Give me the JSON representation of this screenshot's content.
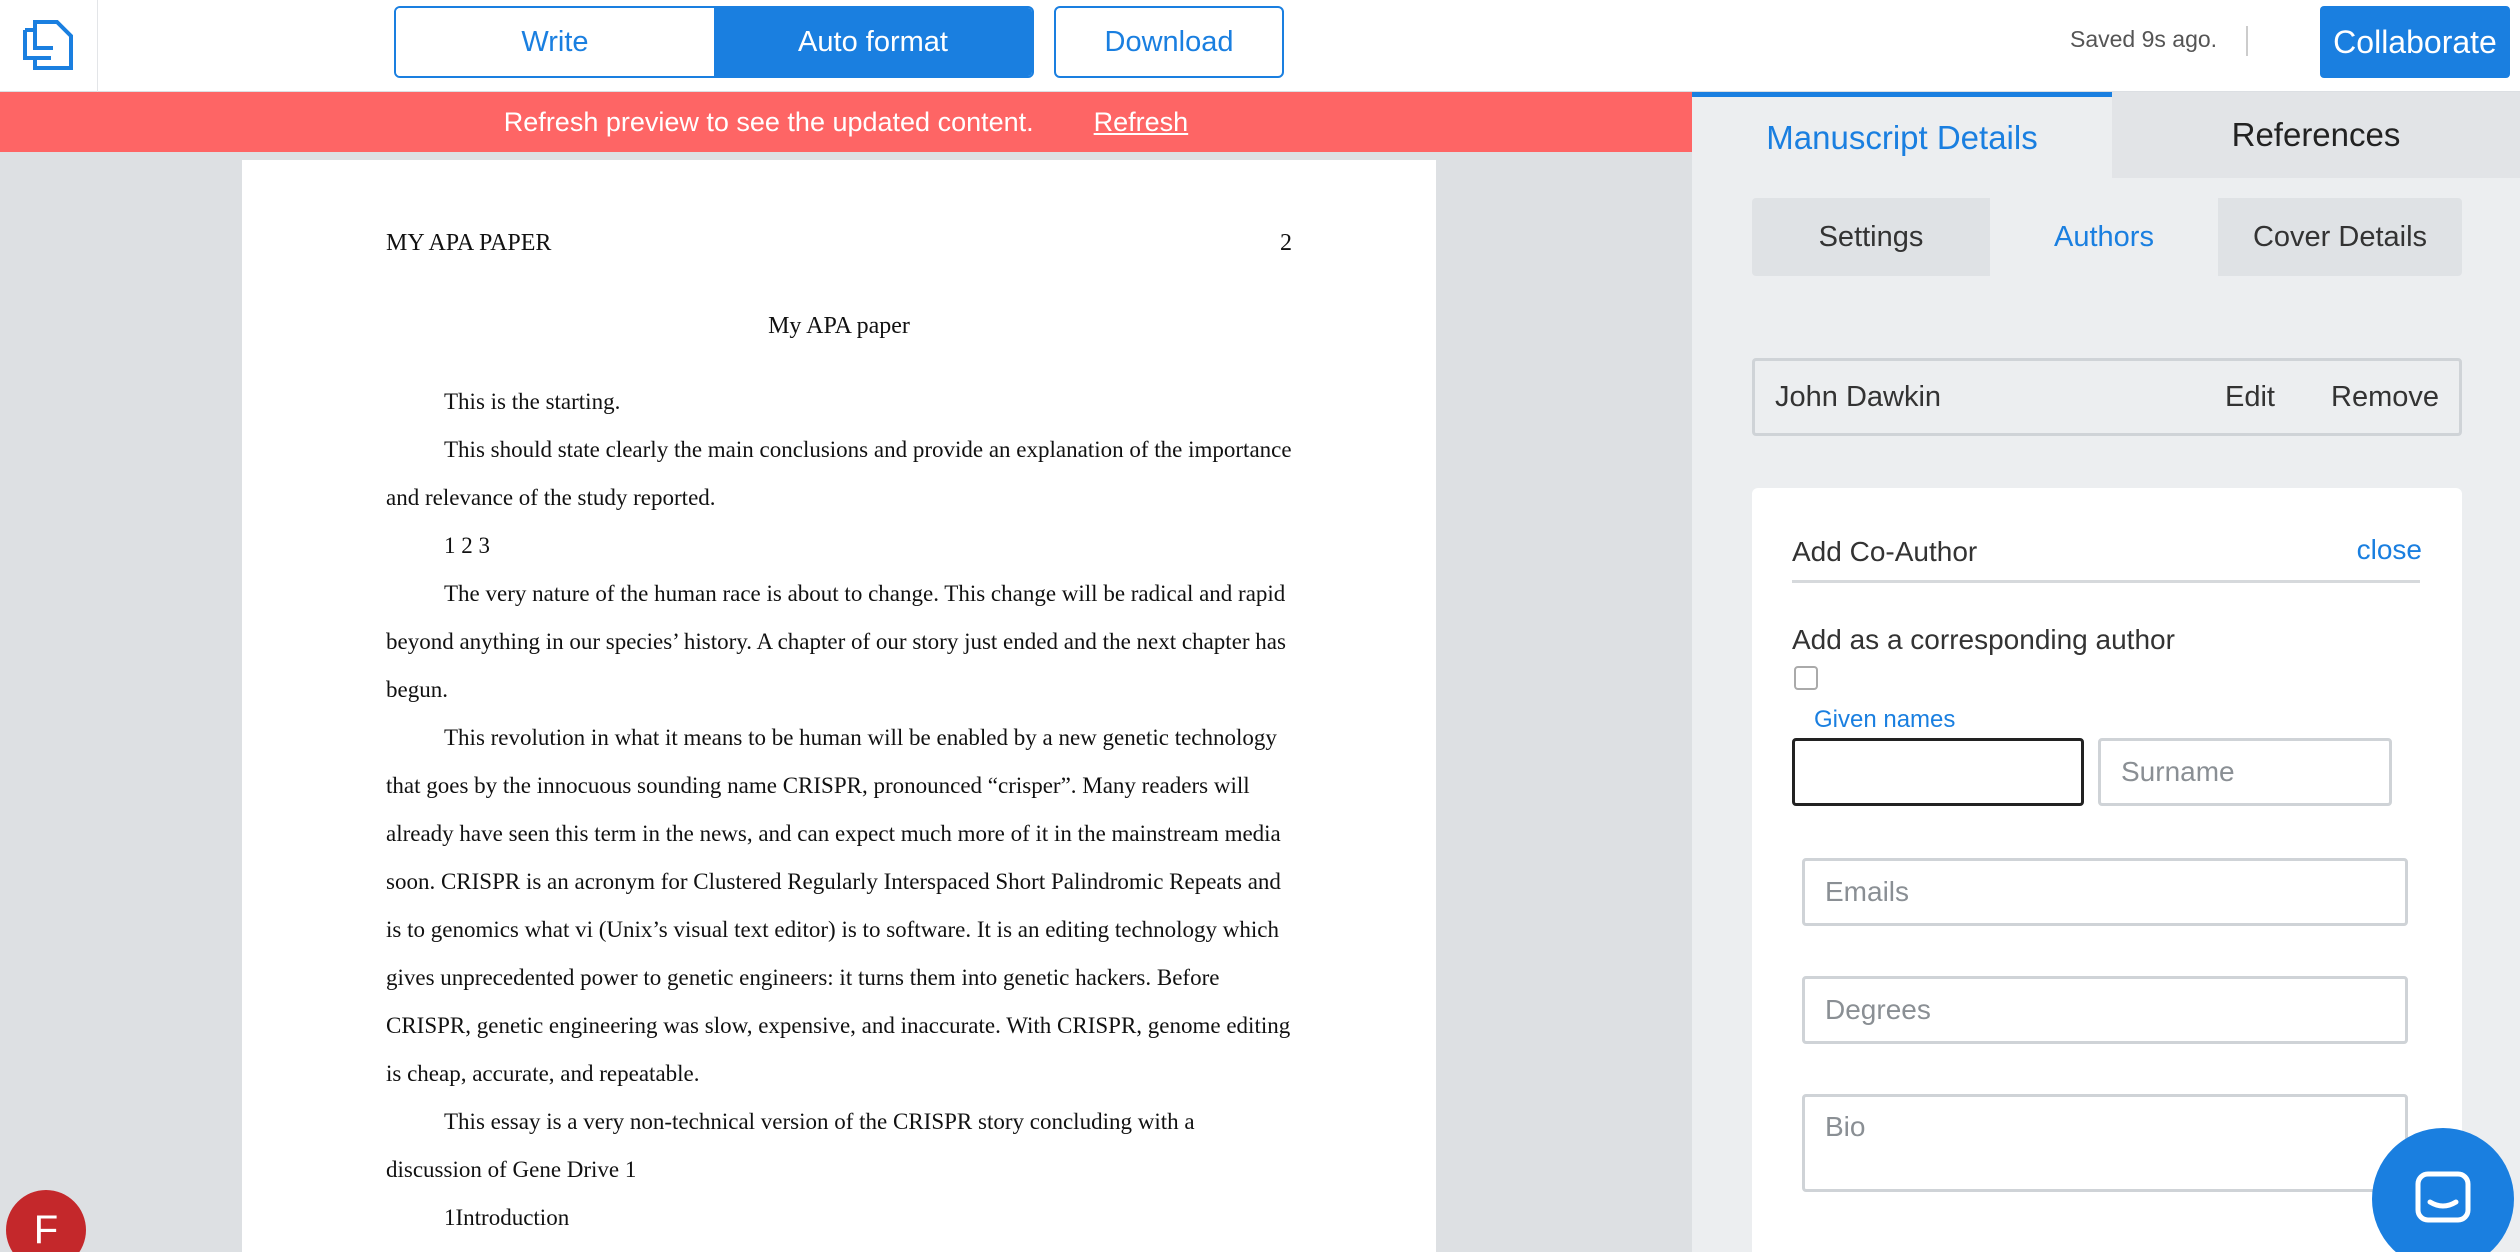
{
  "toolbar": {
    "write_label": "Write",
    "auto_format_label": "Auto format",
    "download_label": "Download",
    "saved_status": "Saved 9s ago.",
    "collaborate_label": "Collaborate"
  },
  "banner": {
    "message": "Refresh preview to see the updated content.",
    "action_label": "Refresh"
  },
  "document": {
    "running_head": "MY APA PAPER",
    "page_number": "2",
    "title": "My APA paper",
    "paragraphs": [
      "This is the starting.",
      "This should state clearly the main conclusions and provide an explanation of the importance and relevance of the study reported.",
      "1 2 3",
      "The very nature of the human race is about to change. This change will be radical and rapid beyond anything in our species’ history. A chapter of our story just ended and the next chapter has begun.",
      "This revolution in what it means to be human will be enabled by a new genetic technology that goes by the innocuous sounding name CRISPR, pronounced “crisper”. Many readers will already have seen this term in the news, and can expect much more of it in the mainstream media soon. CRISPR is an acronym for Clustered Regularly Interspaced Short Palindromic Repeats and is to genomics what vi (Unix’s visual text editor) is to software. It is an editing technology which gives unprecedented power to genetic engineers: it turns them into genetic hackers. Before CRISPR, genetic engineering was slow, expensive, and inaccurate. With CRISPR, genome editing is cheap, accurate, and repeatable.",
      "This essay is a very non-technical version of the CRISPR story concluding with a discussion of Gene Drive 1",
      "1Introduction"
    ]
  },
  "panel": {
    "tabs": {
      "manuscript": "Manuscript Details",
      "references": "References"
    },
    "subtabs": {
      "settings": "Settings",
      "authors": "Authors",
      "cover": "Cover Details"
    },
    "author": {
      "name": "John Dawkin",
      "edit_label": "Edit",
      "remove_label": "Remove"
    },
    "coauthor_form": {
      "title": "Add Co-Author",
      "close_label": "close",
      "corresponding_label": "Add as a corresponding author",
      "given_names_label": "Given names",
      "given_names_value": "",
      "surname_placeholder": "Surname",
      "emails_placeholder": "Emails",
      "degrees_placeholder": "Degrees",
      "bio_placeholder": "Bio"
    }
  },
  "user": {
    "avatar_initial": "F"
  },
  "colors": {
    "accent": "#1a7fe0",
    "banner": "#fe6565",
    "avatar": "#c4282b"
  }
}
